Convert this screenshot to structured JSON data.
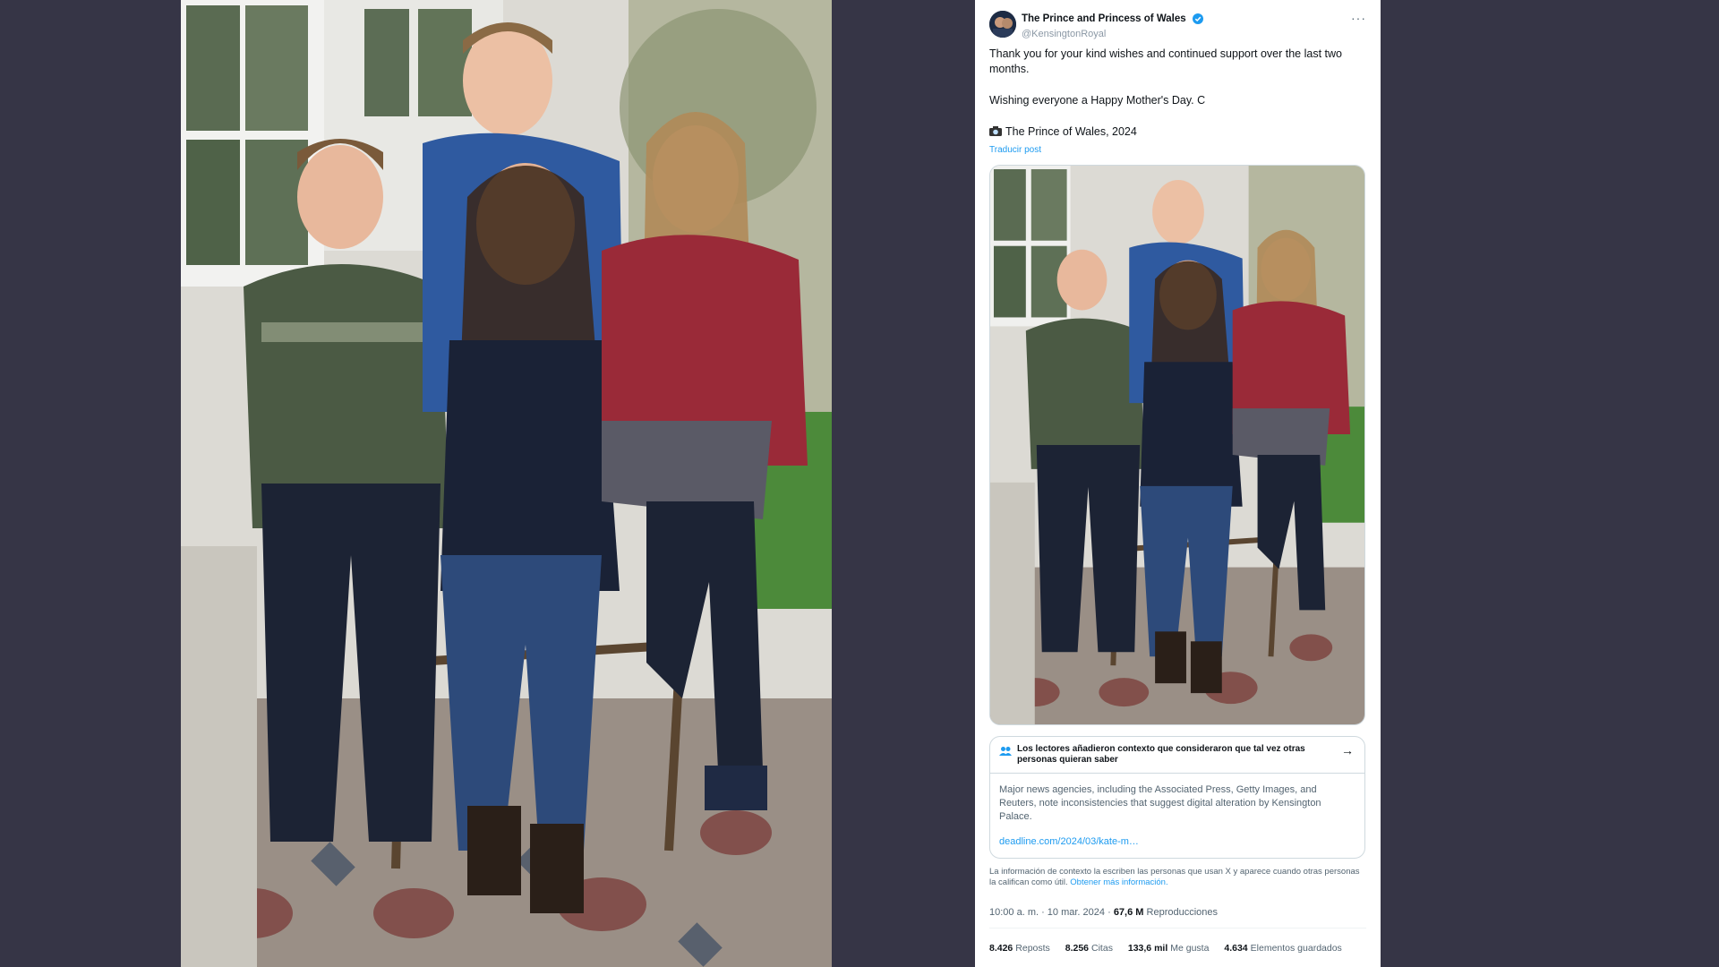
{
  "colors": {
    "page_bg": "#363546",
    "verified_blue": "#1d9bf0",
    "link_blue": "#1d9bf0"
  },
  "tweet": {
    "display_name": "The Prince and Princess of Wales",
    "handle": "@KensingtonRoyal",
    "verified_icon": "verified-badge-icon",
    "more_label": "···",
    "text_line1": "Thank you for your kind wishes and continued support over the last two months.",
    "text_line2": "Wishing everyone a Happy Mother's Day. C",
    "photo_credit": "The Prince of Wales, 2024",
    "photo_credit_icon": "camera-icon",
    "translate_label": "Traducir post",
    "community_note": {
      "icon": "people-icon",
      "title": "Los lectores añadieron contexto que consideraron que tal vez otras personas quieran saber",
      "arrow": "→",
      "text": "Major news agencies, including the Associated Press, Getty Images, and Reuters, note inconsistencies that suggest digital alteration by Kensington Palace.",
      "link": "deadline.com/2024/03/kate-m…"
    },
    "footnote_text": "La información de contexto la escriben las personas que usan X y aparece cuando otras personas la califican como útil.",
    "footnote_link": "Obtener más información.",
    "timestamp": "10:00 a. m. · 10 mar. 2024 ·",
    "views_count": "67,6 M",
    "views_label": "Reproducciones",
    "stats": [
      {
        "count": "8.426",
        "label": "Reposts"
      },
      {
        "count": "8.256",
        "label": "Citas"
      },
      {
        "count": "133,6 mil",
        "label": "Me gusta"
      },
      {
        "count": "4.634",
        "label": "Elementos guardados"
      }
    ]
  }
}
